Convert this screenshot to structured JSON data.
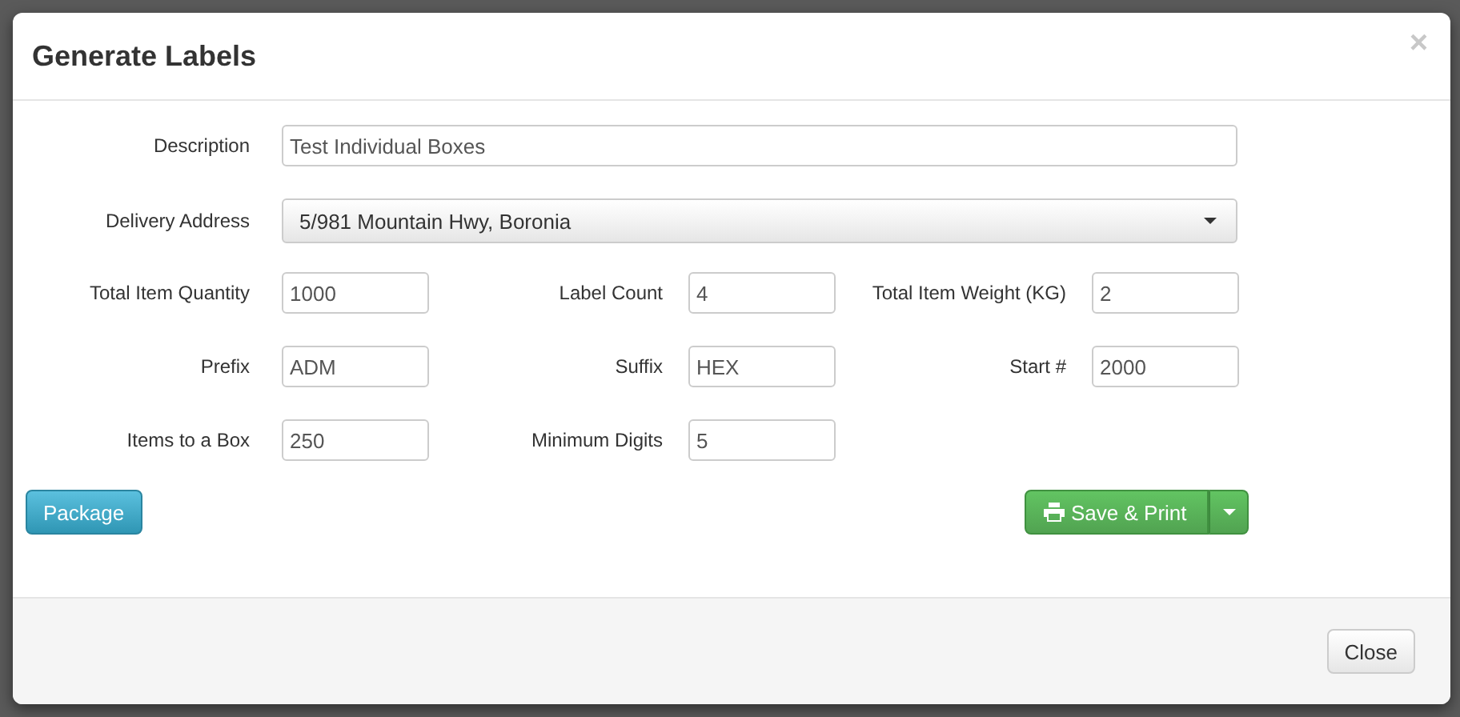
{
  "dialog": {
    "title": "Generate Labels",
    "close_symbol": "×"
  },
  "description": {
    "label": "Description",
    "value": "Test Individual Boxes"
  },
  "delivery_address": {
    "label": "Delivery Address",
    "value": "5/981 Mountain Hwy, Boronia"
  },
  "field_rows": [
    [
      {
        "label": "Total Item Quantity",
        "value": "1000"
      },
      {
        "label": "Label Count",
        "value": "4"
      },
      {
        "label": "Total Item Weight (KG)",
        "value": "2"
      }
    ],
    [
      {
        "label": "Prefix",
        "value": "ADM"
      },
      {
        "label": "Suffix",
        "value": "HEX"
      },
      {
        "label": "Start #",
        "value": "2000"
      }
    ],
    [
      {
        "label": "Items to a Box",
        "value": "250"
      },
      {
        "label": "Minimum Digits",
        "value": "5"
      }
    ]
  ],
  "actions": {
    "package": "Package",
    "save_print": "Save & Print"
  },
  "footer": {
    "close": "Close"
  }
}
